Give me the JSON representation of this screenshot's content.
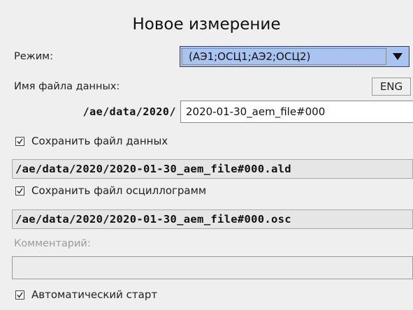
{
  "dialog": {
    "title": "Новое измерение"
  },
  "mode": {
    "label": "Режим:",
    "value": "(АЭ1;ОСЦ1;АЭ2;ОСЦ2)",
    "arrow_icon": "triangle-down-icon"
  },
  "data_file": {
    "label": "Имя файла данных:",
    "lang_button": "ENG",
    "path_prefix": "/ae/data/2020/",
    "filename": "2020-01-30_aem_file#000"
  },
  "save_data": {
    "checked": true,
    "label": "Сохранить файл данных",
    "path": "/ae/data/2020/2020-01-30_aem_file#000.ald"
  },
  "save_osc": {
    "checked": true,
    "label": "Сохранить файл осциллограмм",
    "path": "/ae/data/2020/2020-01-30_aem_file#000.osc"
  },
  "comment": {
    "label": "Комментарий:",
    "value": ""
  },
  "autostart": {
    "checked": true,
    "label": "Автоматический старт"
  },
  "colors": {
    "background": "#efefef",
    "combo_highlight": "#a9c4f1",
    "disabled_text": "#9a9a9a"
  }
}
